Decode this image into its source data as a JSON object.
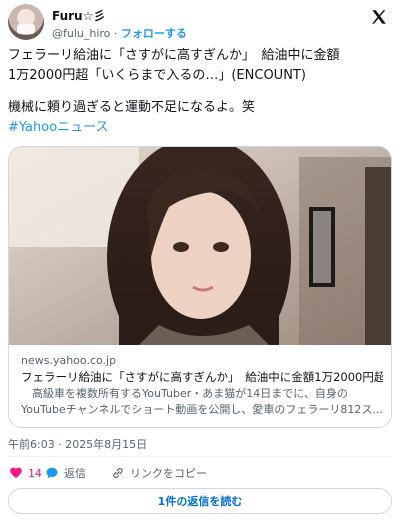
{
  "author": {
    "name": "Furu☆彡",
    "handle": "@fulu_hiro",
    "separator": "·",
    "follow_label": "フォローする"
  },
  "tweet": {
    "lines": [
      "フェラーリ給油に「さすがに高すぎんか」　給油中に金額",
      "1万2000円超「いくらまで入るの…」(ENCOUNT)",
      "機械に頼り過ぎると運動不足になるよ。笑",
      "#Yahooニュース"
    ]
  },
  "card": {
    "domain": "news.yahoo.co.jp",
    "title": "フェラーリ給油に「さすがに高すぎんか」　給油中に金額1万2000円超...",
    "description_lines": [
      "　高級車を複数所有するYouTuber・あま猫が14日までに、自身の",
      "YouTubeチャンネルでショート動画を公開し、愛車のフェラーリ812ス..."
    ]
  },
  "timestamp": "午前6:03 · 2025年8月15日",
  "actions": {
    "like_count": "14",
    "reply_label": "返信",
    "copy_link_label": "リンクをコピー"
  },
  "read_replies_label": "1件の返信を読む",
  "colors": {
    "accent": "#1d9bf0",
    "like": "#f91880",
    "muted": "#536471",
    "border": "#cfd9de"
  }
}
